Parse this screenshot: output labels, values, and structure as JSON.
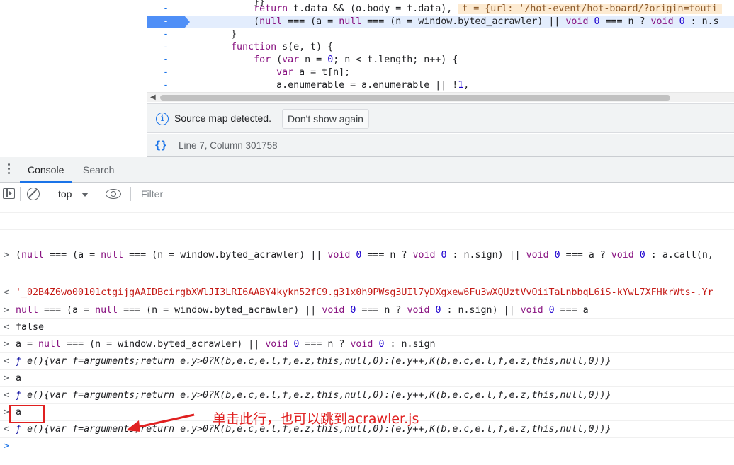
{
  "source": {
    "code_lines": [
      {
        "gutter": "",
        "indent": "            ",
        "parts": [
          {
            "t": "}}",
            "c": "plain"
          }
        ]
      },
      {
        "gutter": "-",
        "indent": "            ",
        "parts": [
          {
            "t": "return ",
            "c": "kw"
          },
          {
            "t": "t.data && (o.body = t.data),",
            "c": "plain"
          }
        ],
        "inline_value": "t = {url: '/hot-event/hot-board/?origin=touti"
      },
      {
        "gutter": "-",
        "indent": "            ",
        "highlight": true,
        "parts": [
          {
            "t": "(",
            "c": "plain"
          },
          {
            "t": "null",
            "c": "kw"
          },
          {
            "t": " === (a = ",
            "c": "plain"
          },
          {
            "t": "null",
            "c": "kw"
          },
          {
            "t": " === (n = window.byted_acrawler) || ",
            "c": "plain"
          },
          {
            "t": "void",
            "c": "kw"
          },
          {
            "t": " ",
            "c": "plain"
          },
          {
            "t": "0",
            "c": "num"
          },
          {
            "t": " === n ? ",
            "c": "plain"
          },
          {
            "t": "void",
            "c": "kw"
          },
          {
            "t": " ",
            "c": "plain"
          },
          {
            "t": "0",
            "c": "num"
          },
          {
            "t": " : n.s",
            "c": "plain"
          }
        ]
      },
      {
        "gutter": "-",
        "indent": "        ",
        "parts": [
          {
            "t": "}",
            "c": "plain"
          }
        ]
      },
      {
        "gutter": "-",
        "indent": "        ",
        "parts": [
          {
            "t": "function",
            "c": "kw"
          },
          {
            "t": " s(e, t) {",
            "c": "plain"
          }
        ]
      },
      {
        "gutter": "-",
        "indent": "            ",
        "parts": [
          {
            "t": "for",
            "c": "kw"
          },
          {
            "t": " (",
            "c": "plain"
          },
          {
            "t": "var",
            "c": "kw"
          },
          {
            "t": " n = ",
            "c": "plain"
          },
          {
            "t": "0",
            "c": "num"
          },
          {
            "t": "; n < t.length; n++) {",
            "c": "plain"
          }
        ]
      },
      {
        "gutter": "-",
        "indent": "                ",
        "parts": [
          {
            "t": "var",
            "c": "kw"
          },
          {
            "t": " a = t[n];",
            "c": "plain"
          }
        ]
      },
      {
        "gutter": "-",
        "indent": "                ",
        "parts": [
          {
            "t": "a.enumerable = a.enumerable || !",
            "c": "plain"
          },
          {
            "t": "1",
            "c": "num"
          },
          {
            "t": ",",
            "c": "plain"
          }
        ]
      }
    ],
    "infobar": {
      "icon": "i",
      "text": "Source map detected.",
      "button_label": "Don't show again"
    },
    "status": {
      "icon": "{}",
      "position": "Line 7, Column 301758"
    }
  },
  "drawer": {
    "tabs": [
      {
        "label": "Console",
        "active": true
      },
      {
        "label": "Search",
        "active": false
      }
    ]
  },
  "toolbar": {
    "context": "top",
    "filter_placeholder": "Filter",
    "filter_value": ""
  },
  "console": {
    "messages": [
      {
        "kind": "input",
        "prompt": ">",
        "parts": [
          {
            "t": "(",
            "c": "result"
          },
          {
            "t": "null",
            "c": "kw"
          },
          {
            "t": " === (a = ",
            "c": "result"
          },
          {
            "t": "null",
            "c": "kw"
          },
          {
            "t": " === (n = window.byted_acrawler) || ",
            "c": "result"
          },
          {
            "t": "void",
            "c": "kw"
          },
          {
            "t": " ",
            "c": "result"
          },
          {
            "t": "0",
            "c": "num"
          },
          {
            "t": " === n ? ",
            "c": "result"
          },
          {
            "t": "void",
            "c": "kw"
          },
          {
            "t": " ",
            "c": "result"
          },
          {
            "t": "0",
            "c": "num"
          },
          {
            "t": " : n.sign) || ",
            "c": "result"
          },
          {
            "t": "void",
            "c": "kw"
          },
          {
            "t": " ",
            "c": "result"
          },
          {
            "t": "0",
            "c": "num"
          },
          {
            "t": " === a ? ",
            "c": "result"
          },
          {
            "t": "void",
            "c": "kw"
          },
          {
            "t": " ",
            "c": "result"
          },
          {
            "t": "0",
            "c": "num"
          },
          {
            "t": " : a.call(n,",
            "c": "result"
          }
        ]
      },
      {
        "kind": "output",
        "prompt": "<",
        "parts": [
          {
            "t": "'_02B4Z6wo00101ctgijgAAIDBcirgbXWlJI3LRI6AABY4kykn52fC9.g31x0h9PWsg3UIl7yDXgxew6Fu3wXQUztVvOiiTaLnbbqL6iS-kYwL7XFHkrWts-.Yr",
            "c": "string"
          }
        ]
      },
      {
        "kind": "input",
        "prompt": ">",
        "parts": [
          {
            "t": "null",
            "c": "kw"
          },
          {
            "t": " === (a = ",
            "c": "result"
          },
          {
            "t": "null",
            "c": "kw"
          },
          {
            "t": " === (n = window.byted_acrawler) || ",
            "c": "result"
          },
          {
            "t": "void",
            "c": "kw"
          },
          {
            "t": " ",
            "c": "result"
          },
          {
            "t": "0",
            "c": "num"
          },
          {
            "t": " === n ? ",
            "c": "result"
          },
          {
            "t": "void",
            "c": "kw"
          },
          {
            "t": " ",
            "c": "result"
          },
          {
            "t": "0",
            "c": "num"
          },
          {
            "t": " : n.sign) || ",
            "c": "result"
          },
          {
            "t": "void",
            "c": "kw"
          },
          {
            "t": " ",
            "c": "result"
          },
          {
            "t": "0",
            "c": "num"
          },
          {
            "t": " === a",
            "c": "result"
          }
        ]
      },
      {
        "kind": "output",
        "prompt": "<",
        "parts": [
          {
            "t": "false",
            "c": "bool"
          }
        ]
      },
      {
        "kind": "input",
        "prompt": ">",
        "parts": [
          {
            "t": "a = ",
            "c": "result"
          },
          {
            "t": "null",
            "c": "kw"
          },
          {
            "t": " === (n = window.byted_acrawler) || ",
            "c": "result"
          },
          {
            "t": "void",
            "c": "kw"
          },
          {
            "t": " ",
            "c": "result"
          },
          {
            "t": "0",
            "c": "num"
          },
          {
            "t": " === n ? ",
            "c": "result"
          },
          {
            "t": "void",
            "c": "kw"
          },
          {
            "t": " ",
            "c": "result"
          },
          {
            "t": "0",
            "c": "num"
          },
          {
            "t": " : n.sign",
            "c": "result"
          }
        ]
      },
      {
        "kind": "output",
        "prompt": "<",
        "parts": [
          {
            "t": "ƒ ",
            "c": "fsym"
          },
          {
            "t": "e(){var f=arguments;return e.y>0?K(b,e.c,e.l,f,e.z,this,null,0):(e.y++,K(b,e.c,e.l,f,e.z,this,null,0))}",
            "c": "fn"
          }
        ]
      },
      {
        "kind": "input",
        "prompt": ">",
        "parts": [
          {
            "t": "a",
            "c": "result"
          }
        ]
      },
      {
        "kind": "output",
        "prompt": "<",
        "parts": [
          {
            "t": "ƒ ",
            "c": "fsym"
          },
          {
            "t": "e(){var f=arguments;return e.y>0?K(b,e.c,e.l,f,e.z,this,null,0):(e.y++,K(b,e.c,e.l,f,e.z,this,null,0))}",
            "c": "fn"
          }
        ]
      },
      {
        "kind": "input",
        "prompt": ">",
        "parts": [
          {
            "t": "a",
            "c": "result"
          }
        ]
      },
      {
        "kind": "output",
        "prompt": "<",
        "parts": [
          {
            "t": "ƒ ",
            "c": "fsym"
          },
          {
            "t": "e(){var f=arguments;return e.y>0?K(b,e.c,e.l,f,e.z,this,null,0):(e.y++,K(b,e.c,e.l,f,e.z,this,null,0))}",
            "c": "fn"
          }
        ]
      }
    ],
    "prompt_symbol": ">"
  },
  "annotation": {
    "text": "单击此行，也可以跳到acrawler.js",
    "color": "#e02020"
  },
  "colors": {
    "accent": "#1a73e8",
    "keyword": "#881280",
    "number": "#1c00cf",
    "string": "#c41a16",
    "highlight_line": "#e3edfd"
  }
}
